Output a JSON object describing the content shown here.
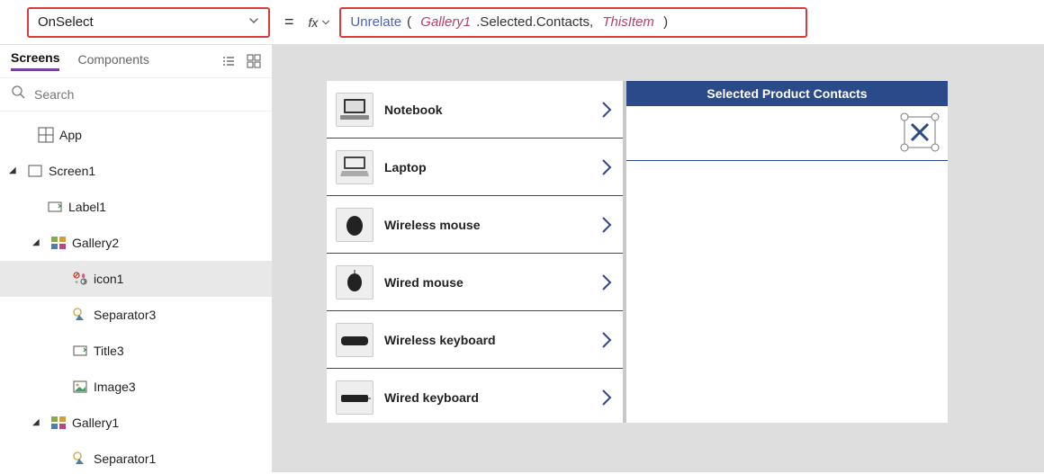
{
  "topbar": {
    "property": "OnSelect",
    "equals": "=",
    "fx": "fx",
    "formula": {
      "fn": "Unrelate",
      "open": "( ",
      "arg1": "Gallery1",
      "dot1": ".Selected.Contacts, ",
      "arg2": "ThisItem",
      "close": " )"
    }
  },
  "sidebar": {
    "tabs": {
      "screens": "Screens",
      "components": "Components"
    },
    "search_placeholder": "Search",
    "items": {
      "app": "App",
      "screen1": "Screen1",
      "label1": "Label1",
      "gallery2": "Gallery2",
      "icon1": "icon1",
      "separator3": "Separator3",
      "title3": "Title3",
      "image3": "Image3",
      "gallery1": "Gallery1",
      "separator1": "Separator1"
    }
  },
  "canvas": {
    "products": {
      "p0": "Notebook",
      "p1": "Laptop",
      "p2": "Wireless mouse",
      "p3": "Wired mouse",
      "p4": "Wireless keyboard",
      "p5": "Wired keyboard"
    },
    "right_title": "Selected Product Contacts"
  }
}
